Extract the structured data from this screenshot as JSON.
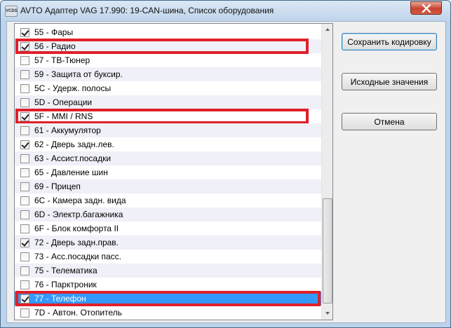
{
  "window": {
    "title": "AVTO Адаптер VAG 17.990: 19-CAN-шина,  Список оборудования",
    "icon_text": "VCDS"
  },
  "equipment_list": {
    "items": [
      {
        "label": "55 - Фары",
        "checked": true,
        "highlighted": false,
        "selected": false
      },
      {
        "label": "56 - Радио",
        "checked": true,
        "highlighted": true,
        "selected": false
      },
      {
        "label": "57 - ТВ-Тюнер",
        "checked": false,
        "highlighted": false,
        "selected": false
      },
      {
        "label": "59 - Защита от буксир.",
        "checked": false,
        "highlighted": false,
        "selected": false
      },
      {
        "label": "5C - Удерж. полосы",
        "checked": false,
        "highlighted": false,
        "selected": false
      },
      {
        "label": "5D - Операции",
        "checked": false,
        "highlighted": false,
        "selected": false
      },
      {
        "label": "5F - MMI / RNS",
        "checked": true,
        "highlighted": true,
        "selected": false
      },
      {
        "label": "61 - Аккумулятор",
        "checked": false,
        "highlighted": false,
        "selected": false
      },
      {
        "label": "62 - Дверь задн.лев.",
        "checked": true,
        "highlighted": false,
        "selected": false
      },
      {
        "label": "63 - Ассист.посадки",
        "checked": false,
        "highlighted": false,
        "selected": false
      },
      {
        "label": "65 - Давление шин",
        "checked": false,
        "highlighted": false,
        "selected": false
      },
      {
        "label": "69 - Прицеп",
        "checked": false,
        "highlighted": false,
        "selected": false
      },
      {
        "label": "6C - Камера задн. вида",
        "checked": false,
        "highlighted": false,
        "selected": false
      },
      {
        "label": "6D - Электр.багажника",
        "checked": false,
        "highlighted": false,
        "selected": false
      },
      {
        "label": "6F - Блок комфорта II",
        "checked": false,
        "highlighted": false,
        "selected": false
      },
      {
        "label": "72 - Дверь задн.прав.",
        "checked": true,
        "highlighted": false,
        "selected": false
      },
      {
        "label": "73 - Асс.посадки пасс.",
        "checked": false,
        "highlighted": false,
        "selected": false
      },
      {
        "label": "75 - Телематика",
        "checked": false,
        "highlighted": false,
        "selected": false
      },
      {
        "label": "76 - Парктроник",
        "checked": false,
        "highlighted": false,
        "selected": false
      },
      {
        "label": "77 - Телефон",
        "checked": true,
        "highlighted": true,
        "selected": true
      },
      {
        "label": "7D - Автон. Отопитель",
        "checked": false,
        "highlighted": false,
        "selected": false
      }
    ],
    "highlight_color": "#e0202a",
    "selection_color": "#3399ff"
  },
  "buttons": {
    "save": "Сохранить кодировку",
    "defaults": "Исходные значения",
    "cancel": "Отмена"
  }
}
